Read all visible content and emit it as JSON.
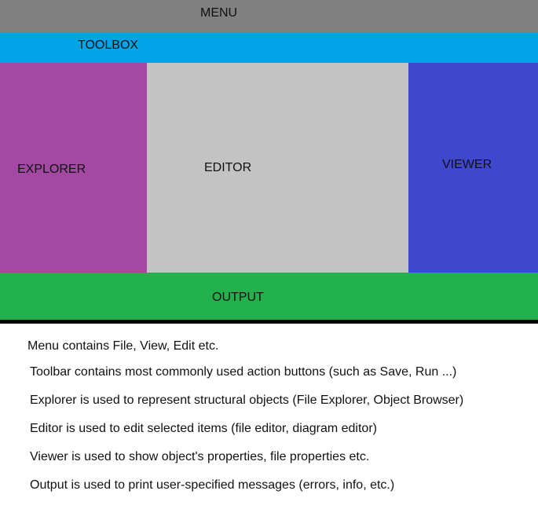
{
  "layout_labels": {
    "menu": "MENU",
    "toolbox": "TOOLBOX",
    "explorer": "EXPLORER",
    "editor": "EDITOR",
    "viewer": "VIEWER",
    "output": "OUTPUT"
  },
  "colors": {
    "menu": "#808080",
    "toolbox": "#00a2e8",
    "explorer": "#a349a4",
    "editor": "#c3c3c3",
    "viewer": "#3f48cc",
    "output": "#22b14c"
  },
  "descriptions": [
    "Menu contains File, View, Edit etc.",
    "Toolbar contains most commonly used action buttons (such as Save, Run ...)",
    "Explorer is used to represent structural objects (File Explorer, Object Browser)",
    "Editor is used to edit selected items (file editor, diagram editor)",
    "Viewer is used to show object's properties, file properties etc.",
    "Output is used to print user-specified messages (errors, info, etc.)"
  ]
}
